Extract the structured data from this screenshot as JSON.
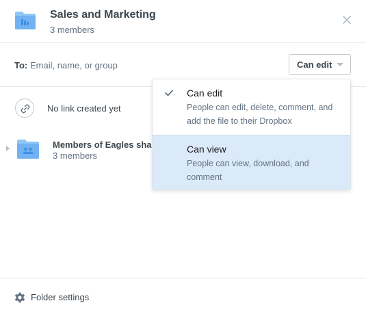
{
  "header": {
    "title": "Sales and Marketing",
    "subtitle": "3 members"
  },
  "share": {
    "to_label": "To:",
    "placeholder": "Email, name, or group",
    "permission_selected": "Can edit"
  },
  "link": {
    "text": "No link created yet"
  },
  "members": [
    {
      "name": "Members of Eagles shared",
      "count": "3 members"
    }
  ],
  "dropdown": {
    "options": [
      {
        "title": "Can edit",
        "description": "People can edit, delete, comment, and add the file to their Dropbox",
        "checked": true
      },
      {
        "title": "Can view",
        "description": "People can view, download, and comment",
        "checked": false
      }
    ]
  },
  "footer": {
    "settings_label": "Folder settings"
  },
  "colors": {
    "folder_blue": "#72b2f2",
    "highlight": "#dbeaf9",
    "muted_text": "#637282"
  }
}
